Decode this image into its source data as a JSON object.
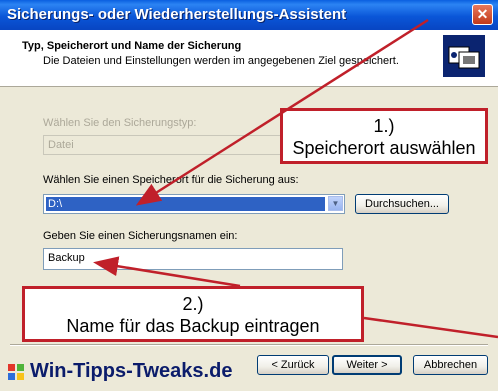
{
  "window": {
    "title": "Sicherungs- oder Wiederherstellungs-Assistent",
    "close_glyph": "✕"
  },
  "header": {
    "title": "Typ, Speicherort und Name der Sicherung",
    "subtitle": "Die Dateien und Einstellungen werden im angegebenen Ziel gespeichert.",
    "icon": "backup-wizard-icon"
  },
  "form": {
    "type_label": "Wählen Sie den Sicherungstyp:",
    "type_value": "Datei",
    "location_label": "Wählen Sie einen Speicherort für die Sicherung aus:",
    "location_value": "D:\\",
    "browse_button": "Durchsuchen...",
    "name_label": "Geben Sie einen Sicherungsnamen ein:",
    "name_value": "Backup"
  },
  "callouts": {
    "one_number": "1.)",
    "one_text": "Speicherort auswählen",
    "two_number": "2.)",
    "two_text": "Name für das Backup eintragen"
  },
  "footer": {
    "brand": "Win-Tipps-Tweaks.de",
    "back_button": "< Zurück",
    "next_button": "Weiter >",
    "cancel_button": "Abbrechen"
  },
  "colors": {
    "titlebar": "#0A56D8",
    "accent_red": "#C0202A",
    "selection": "#2E62C4"
  }
}
